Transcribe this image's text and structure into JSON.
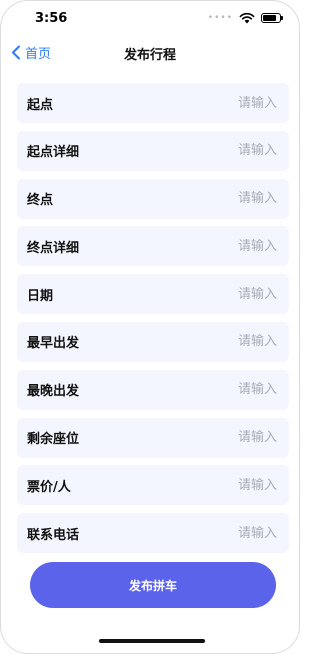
{
  "status_bar": {
    "time": "3:56",
    "signal_dots": "••••"
  },
  "nav": {
    "back_label": "首页",
    "title": "发布行程"
  },
  "form": {
    "placeholder": "请输入",
    "fields": [
      {
        "label": "起点",
        "value": ""
      },
      {
        "label": "起点详细",
        "value": ""
      },
      {
        "label": "终点",
        "value": ""
      },
      {
        "label": "终点详细",
        "value": ""
      },
      {
        "label": "日期",
        "value": ""
      },
      {
        "label": "最早出发",
        "value": ""
      },
      {
        "label": "最晚出发",
        "value": ""
      },
      {
        "label": "剩余座位",
        "value": ""
      },
      {
        "label": "票价/人",
        "value": ""
      },
      {
        "label": "联系电话",
        "value": ""
      }
    ]
  },
  "submit_label": "发布拼车",
  "colors": {
    "accent": "#5b63ea",
    "link": "#2d7cf6",
    "field_bg": "#f3f6fe"
  }
}
